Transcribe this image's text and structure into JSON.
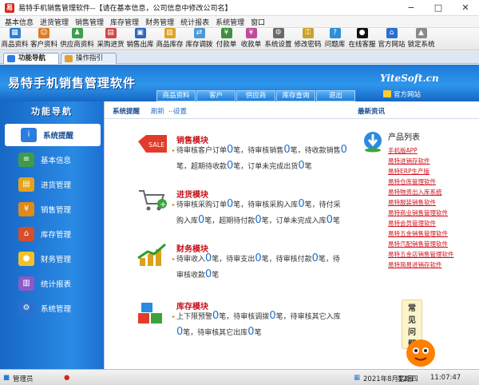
{
  "window": {
    "title": "易特手机销售管理软件--【请在基本信息，公司信息中修改公司名】",
    "minimize": "−",
    "maximize": "□",
    "close": "✕"
  },
  "menu": [
    "基本信息",
    "进货管理",
    "销售管理",
    "库存管理",
    "财务管理",
    "统计报表",
    "系统管理",
    "窗口"
  ],
  "toolbar": [
    {
      "label": "商品资料",
      "color": "#2a7fd4"
    },
    {
      "label": "客户资料",
      "color": "#e07b22"
    },
    {
      "label": "供应商资料",
      "color": "#3aa04a"
    },
    {
      "label": "采购进货",
      "color": "#d64545"
    },
    {
      "label": "销售出库",
      "color": "#2f66c0"
    },
    {
      "label": "商品库存",
      "color": "#e0a320"
    },
    {
      "label": "库存调拨",
      "color": "#4b9ad8"
    },
    {
      "label": "付款单",
      "color": "#3f8f3f"
    },
    {
      "label": "收款单",
      "color": "#c24a9b"
    },
    {
      "label": "系统设置",
      "color": "#6a6a6a"
    },
    {
      "label": "修改密码",
      "color": "#c9a12a"
    },
    {
      "label": "问题库",
      "color": "#2e8fd6"
    },
    {
      "label": "在线客服",
      "color": "#111111"
    },
    {
      "label": "官方网站",
      "color": "#2a6fd0"
    },
    {
      "label": "锁定系统",
      "color": "#8a8a8a"
    }
  ],
  "tabs": [
    {
      "label": "功能导航",
      "active": true
    },
    {
      "label": "操作指引",
      "active": false
    }
  ],
  "banner": {
    "app_name": "易特手机销售管理软件",
    "nav": [
      "商品资料",
      "客户",
      "供应商",
      "库存查询",
      "退出"
    ],
    "brand": "YiteSoft.cn",
    "site_link": "官方网站"
  },
  "sidebar": {
    "header": "功能导航",
    "items": [
      {
        "label": "系统提醒",
        "icon": "info-icon",
        "color": "#2b7de0",
        "active": true
      },
      {
        "label": "基本信息",
        "icon": "database-icon",
        "color": "#3f9b4a",
        "active": false
      },
      {
        "label": "进货管理",
        "icon": "cart-in-icon",
        "color": "#e6a21a",
        "active": false
      },
      {
        "label": "销售管理",
        "icon": "money-icon",
        "color": "#e08a1a",
        "active": false
      },
      {
        "label": "库存管理",
        "icon": "warehouse-icon",
        "color": "#d44f2a",
        "active": false
      },
      {
        "label": "财务管理",
        "icon": "coins-icon",
        "color": "#f0c22a",
        "active": false
      },
      {
        "label": "统计报表",
        "icon": "report-icon",
        "color": "#8a5ac8",
        "active": false
      },
      {
        "label": "系统管理",
        "icon": "gear-icon",
        "color": "#2a6fd0",
        "active": false
      }
    ]
  },
  "crumb": {
    "current": "系统提醒",
    "refresh": "刷新",
    "settings": "设置",
    "news": "最新资讯"
  },
  "modules": {
    "sales": {
      "title": "销售模块",
      "l1a": "待审核客户订单",
      "v1": "0",
      "l1b": "笔，待审核销售",
      "v2": "0",
      "l1c": "笔，待收款销售",
      "v3": "0",
      "l2a": "笔，超期待收款",
      "v4": "0",
      "l2b": "笔，订单未完成出货",
      "v5": "0",
      "l2c": "笔"
    },
    "purchase": {
      "title": "进货模块",
      "l1a": "待审核采购订单",
      "v1": "0",
      "l1b": "笔，待审核采购入库",
      "v2": "0",
      "l1c": "笔，待付采",
      "l2a": "购入库",
      "v3": "0",
      "l2b": "笔，超期待付款",
      "v4": "0",
      "l2c": "笔，订单未完成入库",
      "v5": "0",
      "l2d": "笔"
    },
    "finance": {
      "title": "财务模块",
      "l1a": "待审收入",
      "v1": "0",
      "l1b": "笔，待审支出",
      "v2": "0",
      "l1c": "笔，待审核付款",
      "v3": "0",
      "l1d": "笔，待",
      "l2a": "审核收款",
      "v4": "0",
      "l2b": "笔"
    },
    "stock": {
      "title": "库存模块",
      "l1a": "上下限预警",
      "v1": "0",
      "l1b": "笔，待审核调拨",
      "v2": "0",
      "l1c": "笔，待审核其它入库",
      "v3": "0",
      "l2b": "笔，待审核其它出库",
      "v4": "0",
      "l2c": "笔"
    }
  },
  "products": {
    "header": "产品列表",
    "items": [
      "手机版APP",
      "易特进销存软件",
      "易特ERP生产版",
      "易特仓库管理软件",
      "易特物资出入库系统",
      "易特服装销售软件",
      "易特商业销售管理软件",
      "易特会员管理软件",
      "易特五金销售管理软件",
      "易特汽配销售管理软件",
      "易特五金店销售管理软件",
      "易特简易进销存软件"
    ]
  },
  "faq": [
    "常",
    "见",
    "问",
    "题"
  ],
  "status": {
    "user": "管理员",
    "date": "2021年8月12日",
    "weekday": "星期四",
    "time": "11:07:47"
  }
}
